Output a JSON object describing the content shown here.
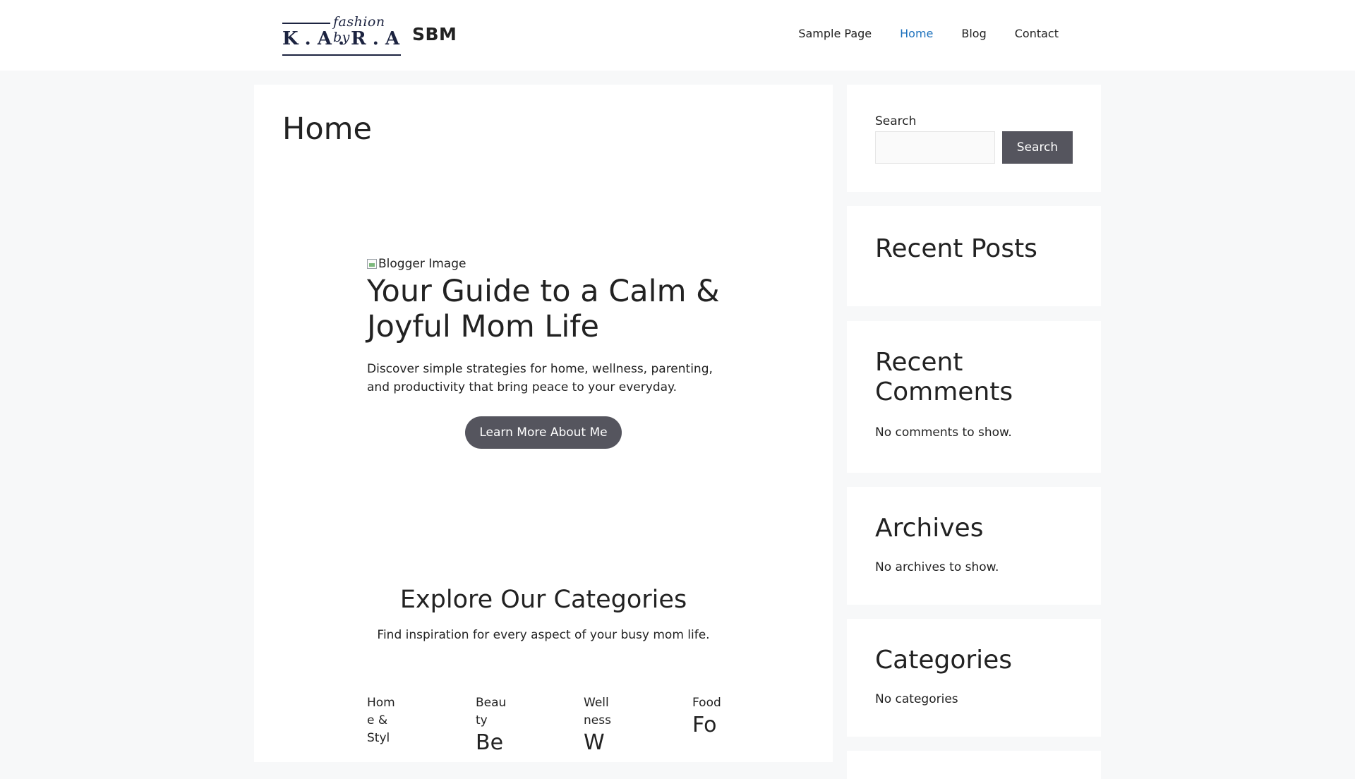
{
  "header": {
    "logo": {
      "script_text": "fashion by",
      "letters": "K . A . R . A"
    },
    "site_title": "SBM",
    "nav": [
      {
        "label": "Sample Page",
        "active": false
      },
      {
        "label": "Home",
        "active": true
      },
      {
        "label": "Blog",
        "active": false
      },
      {
        "label": "Contact",
        "active": false
      }
    ]
  },
  "main": {
    "page_title": "Home",
    "hero": {
      "image_alt": "Blogger Image",
      "title": "Your Guide to a Calm & Joyful Mom Life",
      "description": "Discover simple strategies for home, wellness, parenting, and productivity that bring peace to your everyday.",
      "button_label": "Learn More About Me"
    },
    "categories": {
      "title": "Explore Our Categories",
      "subtitle": "Find inspiration for every aspect of your busy mom life.",
      "items": [
        {
          "image_alt": "Home & Styl",
          "name": ""
        },
        {
          "image_alt": "Beauty",
          "name": "Be"
        },
        {
          "image_alt": "Wellness",
          "name": "W"
        },
        {
          "image_alt": "Food",
          "name": "Fo"
        }
      ]
    }
  },
  "sidebar": {
    "search": {
      "label": "Search",
      "button_label": "Search",
      "value": ""
    },
    "recent_posts": {
      "title": "Recent Posts"
    },
    "recent_comments": {
      "title": "Recent Comments",
      "empty_text": "No comments to show."
    },
    "archives": {
      "title": "Archives",
      "empty_text": "No archives to show."
    },
    "categories": {
      "title": "Categories",
      "empty_text": "No categories"
    }
  },
  "colors": {
    "accent_link": "#1e72bd",
    "button_bg": "#55555e",
    "page_bg": "#f7f8f9",
    "logo": "#1c2340"
  }
}
